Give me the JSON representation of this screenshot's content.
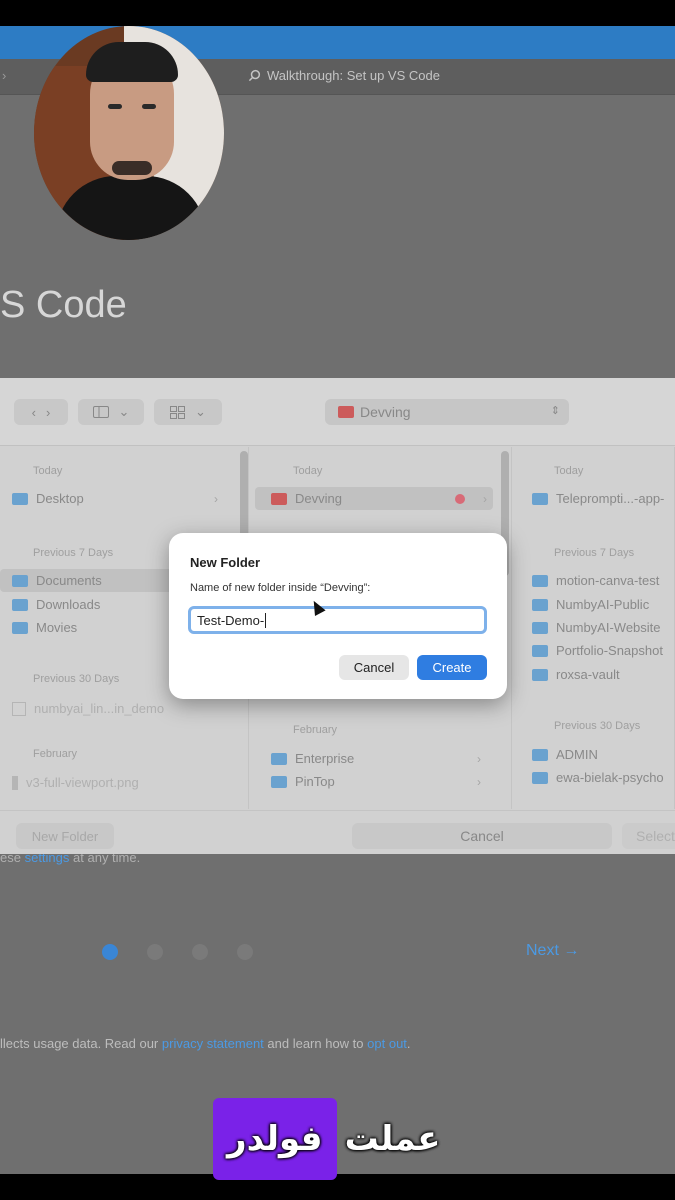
{
  "vscode": {
    "back_glyph": "›",
    "search_text": "Walkthrough: Set up VS Code",
    "heading": "S Code",
    "settings_prefix": "ese",
    "settings_link": "settings",
    "settings_suffix": "at any time.",
    "next_label": "Next →",
    "footer_prefix": "llects usage data. Read our",
    "footer_privacy": "privacy statement",
    "footer_middle": "and learn how to",
    "footer_optout": "opt out",
    "footer_end": ".",
    "accent": "#3a86d6"
  },
  "picker": {
    "toolbar": {
      "back_icon": "chevron-left-icon",
      "forward_icon": "chevron-right-icon",
      "view_icon": "column-view-icon",
      "grid_icon": "grid-view-icon",
      "current_folder": "Devving"
    },
    "column1": {
      "today_label": "Today",
      "today_items": [
        {
          "name": "Desktop"
        }
      ],
      "prev7_label": "Previous 7 Days",
      "prev7_items": [
        {
          "name": "Documents"
        },
        {
          "name": "Downloads"
        },
        {
          "name": "Movies"
        }
      ],
      "prev30_label": "Previous 30 Days",
      "prev30_items": [
        {
          "name": "numbyai_lin...in_demo"
        }
      ],
      "feb_label": "February",
      "feb_items": [
        {
          "name": "v3-full-viewport.png"
        }
      ]
    },
    "column2": {
      "today_label": "Today",
      "today_items": [
        {
          "name": "Devving"
        }
      ],
      "feb_label": "February",
      "feb_items": [
        {
          "name": "Enterprise"
        },
        {
          "name": "PinTop"
        }
      ]
    },
    "column3": {
      "today_label": "Today",
      "today_items": [
        {
          "name": "Teleprompti...-app-"
        }
      ],
      "prev7_label": "Previous 7 Days",
      "prev7_items": [
        {
          "name": "motion-canva-test"
        },
        {
          "name": "NumbyAI-Public"
        },
        {
          "name": "NumbyAI-Website"
        },
        {
          "name": "Portfolio-Snapshot"
        },
        {
          "name": "roxsa-vault"
        }
      ],
      "prev30_label": "Previous 30 Days",
      "prev30_items": [
        {
          "name": "ADMIN"
        },
        {
          "name": "ewa-bielak-psycho"
        }
      ]
    },
    "bottom": {
      "new_folder": "New Folder",
      "cancel": "Cancel",
      "select": "Select"
    }
  },
  "dialog": {
    "title": "New Folder",
    "label": "Name of new folder inside “Devving”:",
    "input_value": "Test-Demo-",
    "cancel": "Cancel",
    "create": "Create",
    "create_color": "#2f7de1"
  },
  "caption": {
    "word1": "عملت",
    "word2": "فولدر",
    "highlight_color": "#7a22e8"
  }
}
